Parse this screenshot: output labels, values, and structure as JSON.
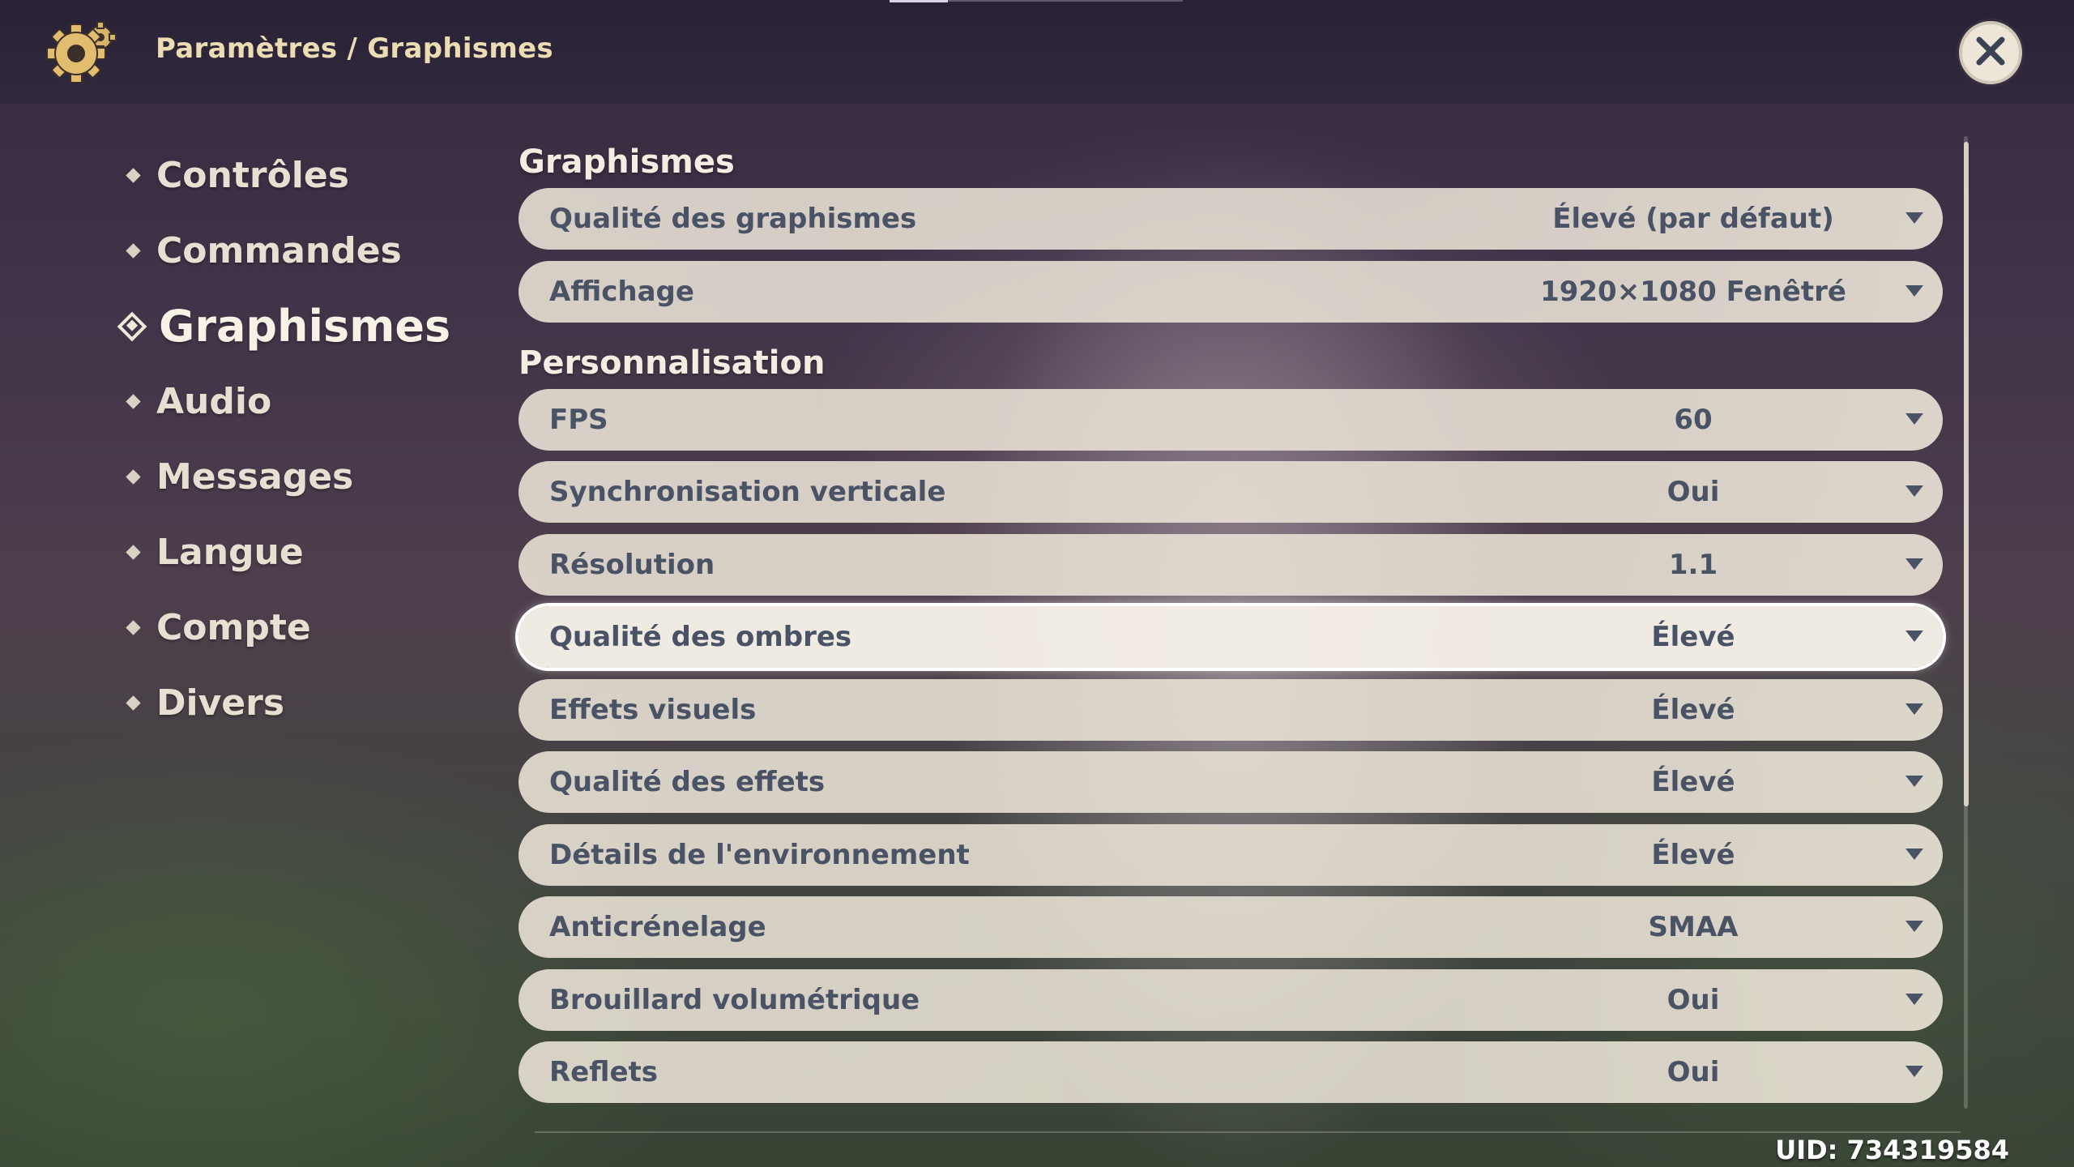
{
  "header": {
    "breadcrumb_parent": "Paramètres",
    "breadcrumb_separator": "/",
    "breadcrumb_current": "Graphismes"
  },
  "sidebar": {
    "items": [
      {
        "label": "Contrôles",
        "active": false
      },
      {
        "label": "Commandes",
        "active": false
      },
      {
        "label": "Graphismes",
        "active": true
      },
      {
        "label": "Audio",
        "active": false
      },
      {
        "label": "Messages",
        "active": false
      },
      {
        "label": "Langue",
        "active": false
      },
      {
        "label": "Compte",
        "active": false
      },
      {
        "label": "Divers",
        "active": false
      }
    ]
  },
  "sections": {
    "graphismes": {
      "title": "Graphismes",
      "rows": [
        {
          "label": "Qualité des graphismes",
          "value": "Élevé (par défaut)"
        },
        {
          "label": "Affichage",
          "value": "1920×1080 Fenêtré"
        }
      ]
    },
    "personnalisation": {
      "title": "Personnalisation",
      "rows": [
        {
          "label": "FPS",
          "value": "60"
        },
        {
          "label": "Synchronisation verticale",
          "value": "Oui"
        },
        {
          "label": "Résolution",
          "value": "1.1"
        },
        {
          "label": "Qualité des ombres",
          "value": "Élevé",
          "selected": true
        },
        {
          "label": "Effets visuels",
          "value": "Élevé"
        },
        {
          "label": "Qualité des effets",
          "value": "Élevé"
        },
        {
          "label": "Détails de l'environnement",
          "value": "Élevé"
        },
        {
          "label": "Anticrénelage",
          "value": "SMAA"
        },
        {
          "label": "Brouillard volumétrique",
          "value": "Oui"
        },
        {
          "label": "Reflets",
          "value": "Oui"
        }
      ]
    }
  },
  "footer": {
    "uid": "UID: 734319584"
  },
  "colors": {
    "accent_gold": "#ecdcb4",
    "row_bg": "#ece5d8",
    "row_text": "#4a5366"
  }
}
